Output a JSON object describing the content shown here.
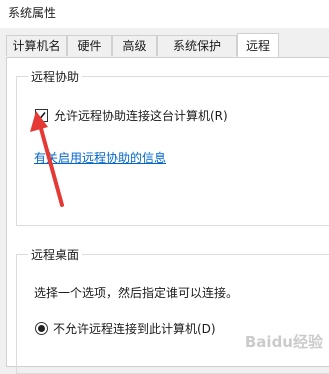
{
  "window": {
    "title": "系统属性"
  },
  "tabs": [
    {
      "label": "计算机名"
    },
    {
      "label": "硬件"
    },
    {
      "label": "高级"
    },
    {
      "label": "系统保护"
    },
    {
      "label": "远程"
    }
  ],
  "remote_assistance": {
    "group_label": "远程协助",
    "checkbox_label": "允许远程协助连接这台计算机(R)",
    "checkbox_checked": true,
    "info_link": "有关启用远程协助的信息"
  },
  "remote_desktop": {
    "group_label": "远程桌面",
    "instruction": "选择一个选项，然后指定谁可以连接。",
    "option_deny": "不允许远程连接到此计算机(D)",
    "option_deny_selected": true
  },
  "watermark": "Baidu经验",
  "colors": {
    "link": "#0066cc",
    "arrow": "#e53935"
  }
}
